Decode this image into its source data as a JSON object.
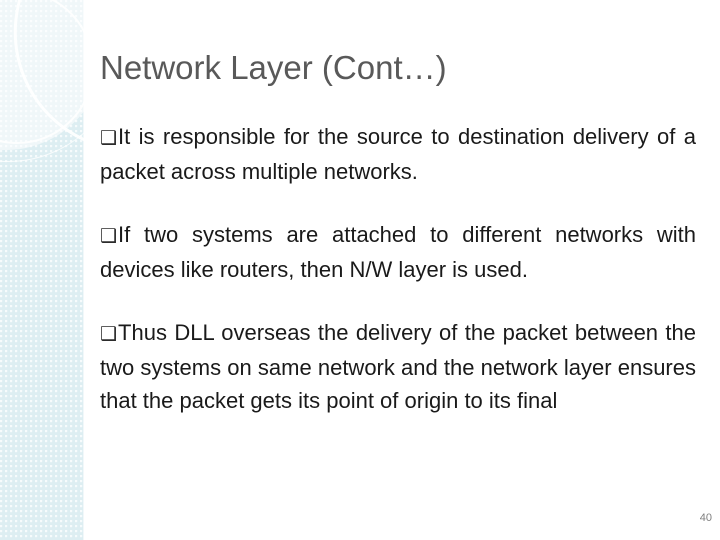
{
  "slide": {
    "title_main": "Network Layer ",
    "title_cont": "(Cont…)",
    "bullet_marker": "❑",
    "bullets": [
      "It is responsible for the source to destination delivery of a packet across multiple networks.",
      "If two systems are attached to different networks with devices like routers, then N/W layer is used.",
      "Thus DLL overseas the delivery of the packet between the two systems on same network and the network layer ensures that the packet gets its point of origin to its final"
    ],
    "page_number": "40",
    "colors": {
      "band": "#ddeef2",
      "title": "#595959",
      "body_text": "#1a1a1a"
    }
  }
}
